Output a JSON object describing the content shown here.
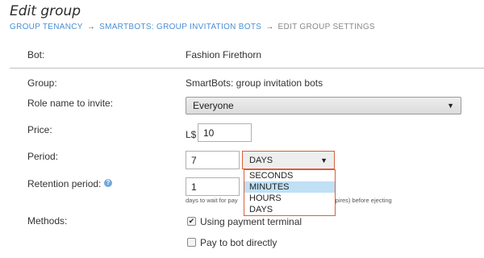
{
  "page": {
    "title": "Edit group"
  },
  "breadcrumb": {
    "items": [
      "GROUP TENANCY",
      "SMARTBOTS: GROUP INVITATION BOTS",
      "EDIT GROUP SETTINGS"
    ],
    "separator": "→"
  },
  "form": {
    "bot": {
      "label": "Bot:",
      "value": "Fashion Firethorn"
    },
    "group": {
      "label": "Group:",
      "value": "SmartBots: group invitation bots"
    },
    "role": {
      "label": "Role name to invite:",
      "selected": "Everyone"
    },
    "price": {
      "label": "Price:",
      "currency": "L$",
      "value": "10"
    },
    "period": {
      "label": "Period:",
      "value": "7",
      "unit_selected": "DAYS",
      "options": [
        "SECONDS",
        "MINUTES",
        "HOURS",
        "DAYS"
      ],
      "highlighted_option": "MINUTES"
    },
    "retention": {
      "label": "Retention period:",
      "value": "1",
      "hint_left": "days to wait for pay",
      "hint_right": "pires) before ejecting"
    },
    "methods": {
      "label": "Methods:",
      "options": [
        {
          "label": "Using payment terminal",
          "checked": true
        },
        {
          "label": "Pay to bot directly",
          "checked": false
        }
      ]
    }
  },
  "icons": {
    "dropdown_caret": "caret-down-icon",
    "help": "question-icon",
    "checkmark": "checkmark-icon"
  },
  "colors": {
    "link": "#4a8fd6",
    "focus_border": "#d9603b",
    "highlight": "#bfe0f5",
    "help_icon": "#6fa8dc"
  }
}
